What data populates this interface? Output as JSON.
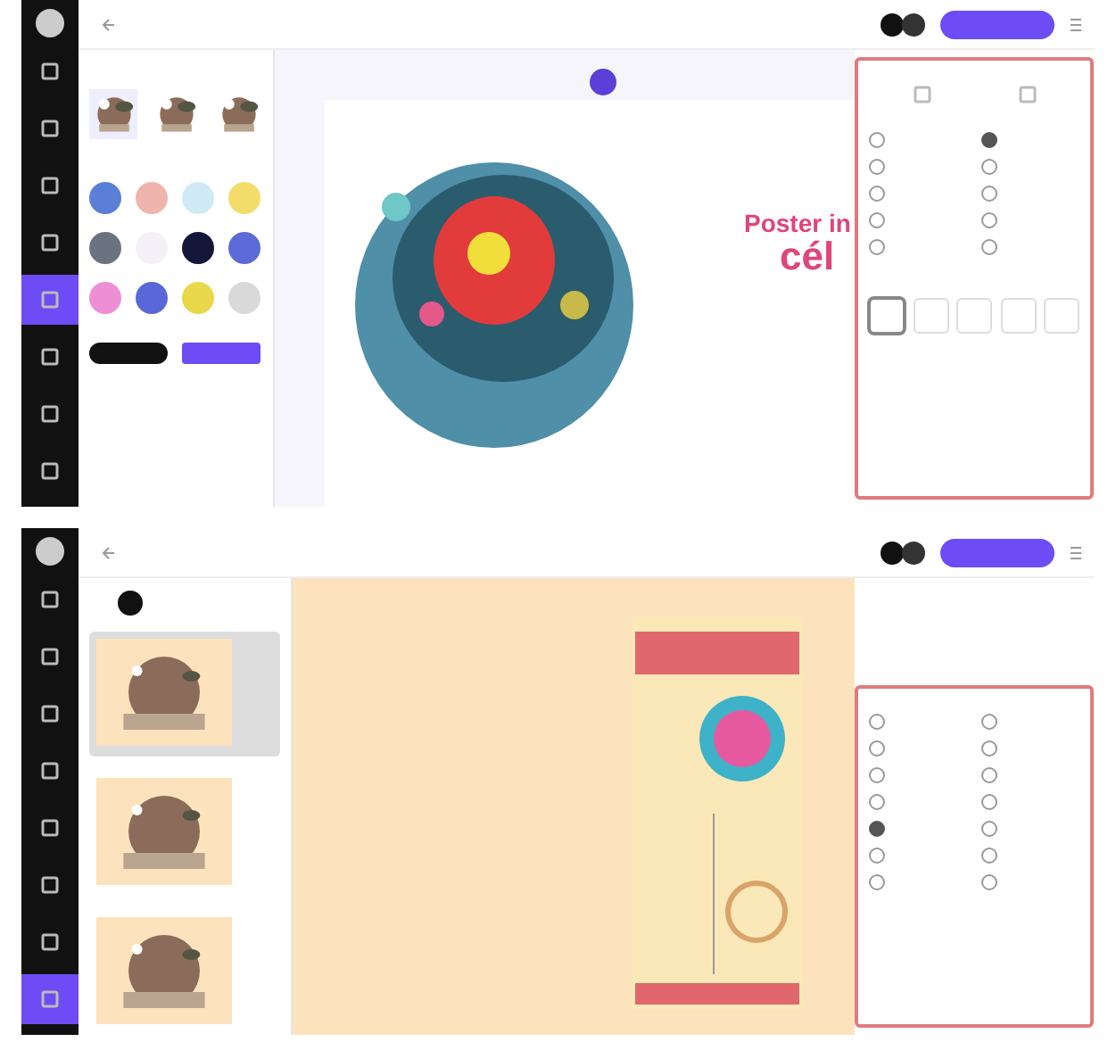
{
  "screens": [
    {
      "kind": "cell",
      "sidebar": [
        {
          "selected": false
        },
        {
          "selected": false
        },
        {
          "selected": false
        },
        {
          "selected": false
        },
        {
          "selected": true
        },
        {
          "selected": false
        },
        {
          "selected": false
        },
        {
          "selected": false
        }
      ],
      "swatches": [
        {
          "color": "#5b7fd6"
        },
        {
          "color": "#f0b4ae"
        },
        {
          "color": "#cfe9f5"
        },
        {
          "color": "#f2dd6b"
        },
        {
          "color": "#6b7280"
        },
        {
          "color": "#f5f0f7"
        },
        {
          "color": "#14163a"
        },
        {
          "color": "#5d6ad8"
        },
        {
          "color": "#ee8fd6"
        },
        {
          "color": "#5a67d8"
        },
        {
          "color": "#e8d84a"
        },
        {
          "color": "#d9d9d9"
        }
      ],
      "poster_title": "Poster in",
      "poster_word": "cél",
      "options": [
        {
          "selected": false
        },
        {
          "selected": true
        },
        {
          "selected": false
        },
        {
          "selected": false
        },
        {
          "selected": false
        },
        {
          "selected": false
        },
        {
          "selected": false
        },
        {
          "selected": false
        },
        {
          "selected": false
        },
        {
          "selected": false
        }
      ],
      "alignment": [
        {
          "selected": true
        },
        {
          "selected": false
        },
        {
          "selected": false
        },
        {
          "selected": false
        },
        {
          "selected": false
        }
      ]
    },
    {
      "kind": "poster",
      "sidebar": [
        {
          "selected": false
        },
        {
          "selected": false
        },
        {
          "selected": false
        },
        {
          "selected": false
        },
        {
          "selected": false
        },
        {
          "selected": false
        },
        {
          "selected": false
        },
        {
          "selected": true
        }
      ],
      "slides": [
        {
          "selected": true
        },
        {
          "selected": false
        },
        {
          "selected": false
        }
      ],
      "options": [
        {
          "selected": false
        },
        {
          "selected": false
        },
        {
          "selected": false
        },
        {
          "selected": false
        },
        {
          "selected": false
        },
        {
          "selected": false
        },
        {
          "selected": false
        },
        {
          "selected": false
        },
        {
          "selected": true
        },
        {
          "selected": false
        },
        {
          "selected": false
        },
        {
          "selected": false
        },
        {
          "selected": false
        },
        {
          "selected": false
        }
      ]
    }
  ]
}
